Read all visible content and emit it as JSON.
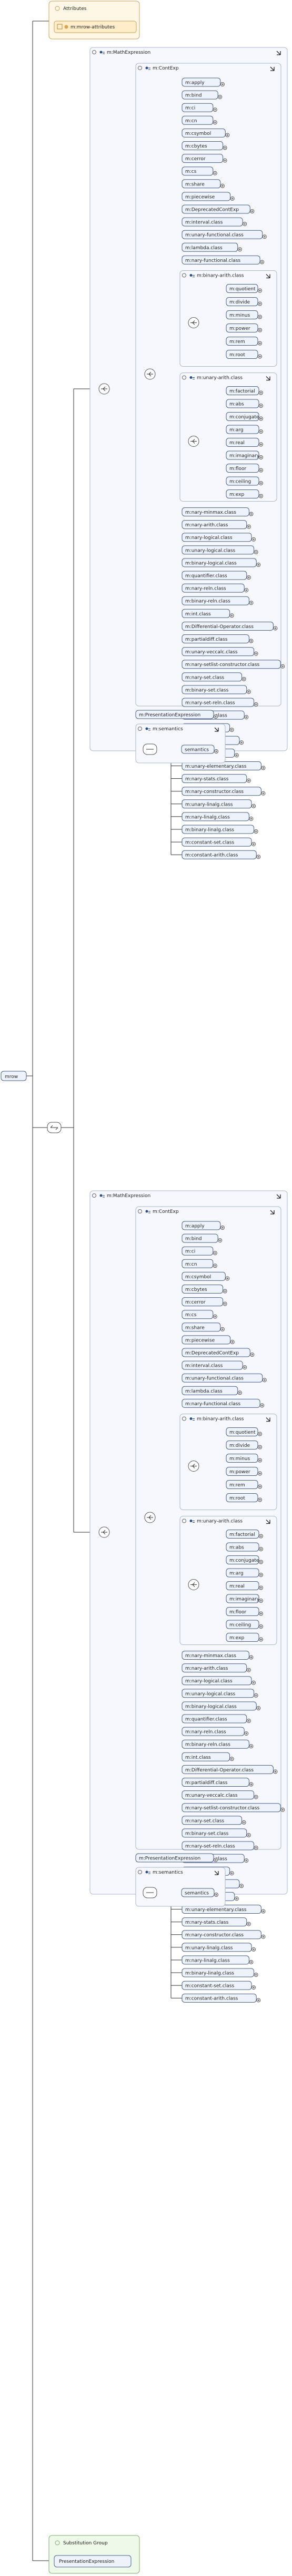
{
  "root": {
    "label": "mrow"
  },
  "attributes": {
    "title": "Attributes",
    "group": "m:mrow-attributes",
    "colors": {
      "fill": "#fff7e6",
      "stroke": "#c8a35a"
    }
  },
  "substitution_group": {
    "title": "Substitution Group",
    "item": "PresentationExpression",
    "colors": {
      "fill": "#eef9ea",
      "stroke": "#7cab6c"
    }
  },
  "branches": [
    {
      "math_expression": "m:MathExpression",
      "cont_exp": "m:ContExp",
      "leaf_items_a": [
        "m:apply",
        "m:bind",
        "m:ci",
        "m:cn",
        "m:csymbol",
        "m:cbytes",
        "m:cerror",
        "m:cs",
        "m:share",
        "m:piecewise",
        "m:DeprecatedContExp",
        "m:interval.class",
        "m:unary-functional.class",
        "m:lambda.class",
        "m:nary-functional.class"
      ],
      "binary_arith": {
        "title": "m:binary-arith.class",
        "items": [
          "m:quotient",
          "m:divide",
          "m:minus",
          "m:power",
          "m:rem",
          "m:root"
        ]
      },
      "unary_arith": {
        "title": "m:unary-arith.class",
        "items": [
          "m:factorial",
          "m:abs",
          "m:conjugate",
          "m:arg",
          "m:real",
          "m:imaginary",
          "m:floor",
          "m:ceiling",
          "m:exp"
        ]
      },
      "leaf_items_b": [
        "m:nary-minmax.class",
        "m:nary-arith.class",
        "m:nary-logical.class",
        "m:unary-logical.class",
        "m:binary-logical.class",
        "m:quantifier.class",
        "m:nary-reln.class",
        "m:binary-reln.class",
        "m:int.class",
        "m:Differential-Operator.class",
        "m:partialdiff.class",
        "m:unary-veccalc.class",
        "m:nary-setlist-constructor.class",
        "m:nary-set.class",
        "m:binary-set.class",
        "m:nary-set-reln.class",
        "m:unary-set.class",
        "m:sum.class",
        "m:product.class",
        "m:limit.class",
        "m:unary-elementary.class",
        "m:nary-stats.class",
        "m:nary-constructor.class",
        "m:unary-linalg.class",
        "m:nary-linalg.class",
        "m:binary-linalg.class",
        "m:constant-set.class",
        "m:constant-arith.class"
      ],
      "presentation_expression": "m:PresentationExpression",
      "semantics_group": "m:semantics",
      "semantics": "semantics"
    },
    {
      "math_expression": "m:MathExpression",
      "cont_exp": "m:ContExp",
      "leaf_items_a": [
        "m:apply",
        "m:bind",
        "m:ci",
        "m:cn",
        "m:csymbol",
        "m:cbytes",
        "m:cerror",
        "m:cs",
        "m:share",
        "m:piecewise",
        "m:DeprecatedContExp",
        "m:interval.class",
        "m:unary-functional.class",
        "m:lambda.class",
        "m:nary-functional.class"
      ],
      "binary_arith": {
        "title": "m:binary-arith.class",
        "items": [
          "m:quotient",
          "m:divide",
          "m:minus",
          "m:power",
          "m:rem",
          "m:root"
        ]
      },
      "unary_arith": {
        "title": "m:unary-arith.class",
        "items": [
          "m:factorial",
          "m:abs",
          "m:conjugate",
          "m:arg",
          "m:real",
          "m:imaginary",
          "m:floor",
          "m:ceiling",
          "m:exp"
        ]
      },
      "leaf_items_b": [
        "m:nary-minmax.class",
        "m:nary-arith.class",
        "m:nary-logical.class",
        "m:unary-logical.class",
        "m:binary-logical.class",
        "m:quantifier.class",
        "m:nary-reln.class",
        "m:binary-reln.class",
        "m:int.class",
        "m:Differential-Operator.class",
        "m:partialdiff.class",
        "m:unary-veccalc.class",
        "m:nary-setlist-constructor.class",
        "m:nary-set.class",
        "m:binary-set.class",
        "m:nary-set-reln.class",
        "m:unary-set.class",
        "m:sum.class",
        "m:product.class",
        "m:limit.class",
        "m:unary-elementary.class",
        "m:nary-stats.class",
        "m:nary-constructor.class",
        "m:unary-linalg.class",
        "m:nary-linalg.class",
        "m:binary-linalg.class",
        "m:constant-set.class",
        "m:constant-arith.class"
      ],
      "presentation_expression": "m:PresentationExpression",
      "semantics_group": "m:semantics",
      "semantics": "semantics"
    }
  ],
  "colors": {
    "element_fill": "#eef3fb",
    "element_stroke": "#4a5f86",
    "group_fill": "#f6f8fd",
    "group_stroke": "#a9b6cc",
    "connector": "#333333",
    "compositor_fill": "#ffffff",
    "compositor_stroke": "#555555"
  }
}
